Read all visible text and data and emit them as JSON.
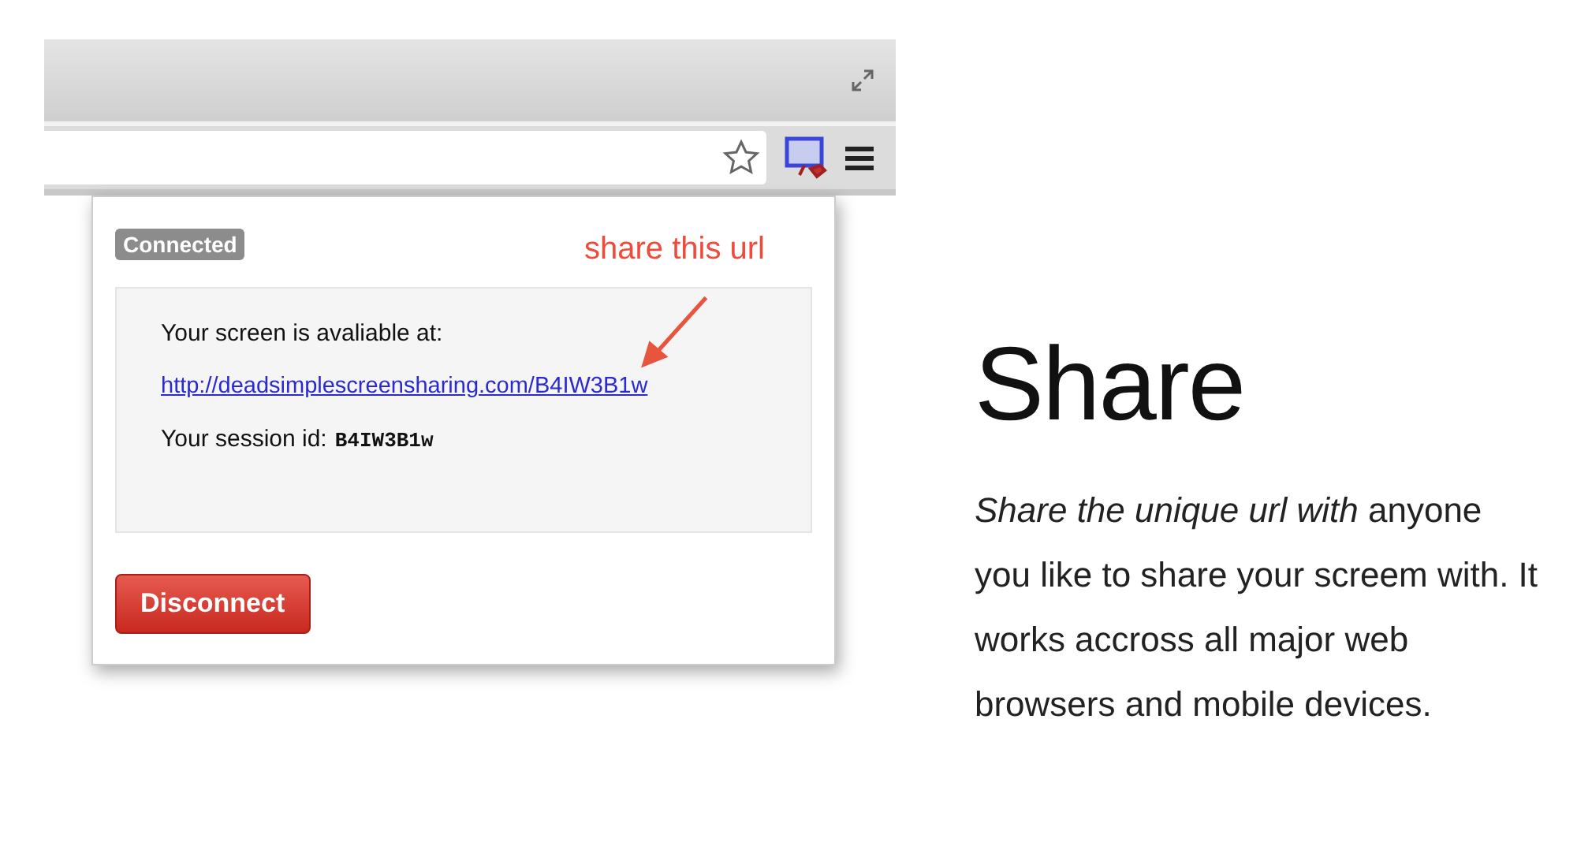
{
  "popup": {
    "status": "Connected",
    "annotation": "share this url",
    "intro": "Your screen is avaliable at:",
    "url": "http://deadsimplescreensharing.com/B4IW3B1w",
    "session_label": "Your session id:",
    "session_id": "B4IW3B1w",
    "button": "Disconnect"
  },
  "feature": {
    "title": "Share",
    "description": "*Share the unique url with* anyone you like to share your screem with. It works accross all major web browsers and mobile devices."
  }
}
